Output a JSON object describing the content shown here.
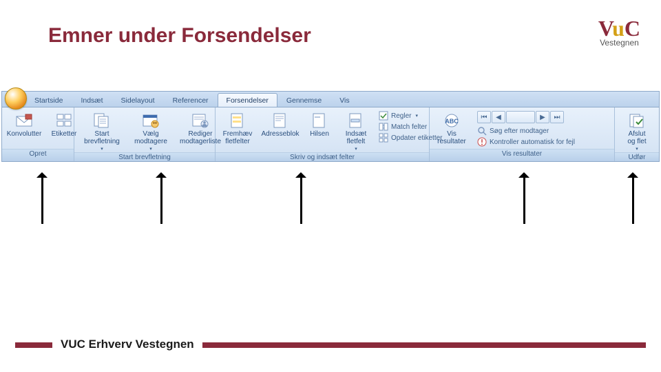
{
  "title": "Emner under Forsendelser",
  "logo": {
    "brand_pre": "V",
    "brand_mid": "u",
    "brand_post": "C",
    "sub": "Vestegnen"
  },
  "tabs": [
    "Startside",
    "Indsæt",
    "Sidelayout",
    "Referencer",
    "Forsendelser",
    "Gennemse",
    "Vis"
  ],
  "active_tab_index": 4,
  "groups": {
    "opret": {
      "label": "Opret",
      "konvolutter": "Konvolutter",
      "etiketter": "Etiketter"
    },
    "start": {
      "label": "Start brevfletning",
      "start_brev": "Start\nbrevfletning",
      "vaelg": "Vælg\nmodtagere",
      "rediger": "Rediger\nmodtagerliste"
    },
    "skriv": {
      "label": "Skriv og indsæt felter",
      "fremhaev": "Fremhæv\nfletfelter",
      "adresse": "Adresseblok",
      "hilsen": "Hilsen",
      "indsaet": "Indsæt\nfletfelt",
      "regler": "Regler",
      "match": "Match felter",
      "opdater": "Opdater etiketter"
    },
    "vis": {
      "label": "Vis resultater",
      "vis_res": "Vis\nresultater",
      "sog": "Søg efter modtager",
      "kontrol": "Kontroller automatisk for fejl"
    },
    "udfor": {
      "label": "Udfør",
      "afslut": "Afslut\nog flet"
    }
  },
  "footer": "VUC Erhverv Vestegnen"
}
